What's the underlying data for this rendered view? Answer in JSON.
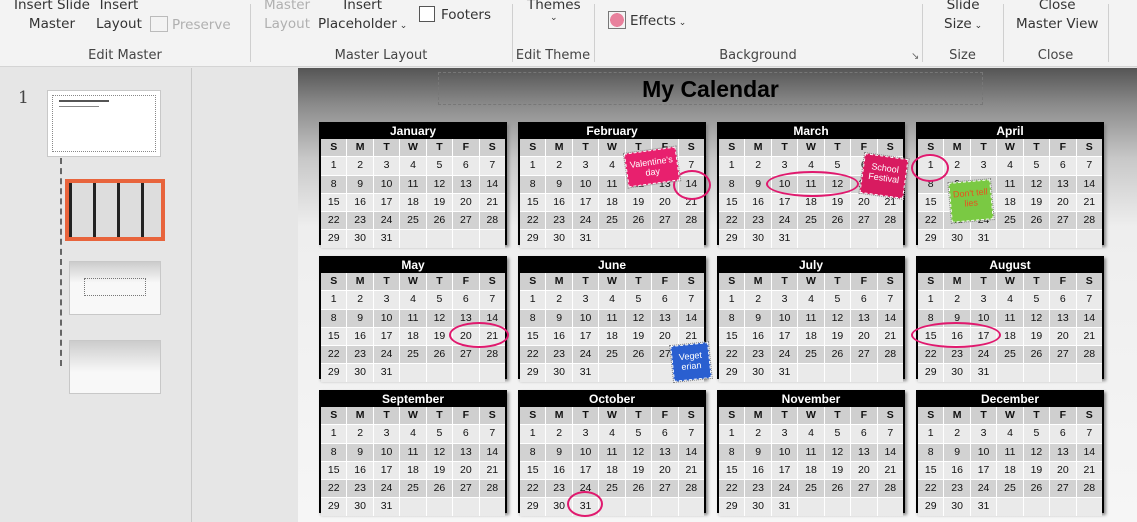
{
  "ribbon": {
    "insert_slide_master": [
      "Insert Slide",
      "Master"
    ],
    "insert_layout": [
      "Insert",
      "Layout"
    ],
    "preserve": "Preserve",
    "master_layout": [
      "Master",
      "Layout"
    ],
    "insert_placeholder": [
      "Insert",
      "Placeholder"
    ],
    "footers": "Footers",
    "footers_checked": false,
    "themes": "Themes",
    "effects": "Effects",
    "slide_size": [
      "Slide",
      "Size"
    ],
    "close_master_view": [
      "Close",
      "Master View"
    ],
    "groups": [
      "Edit Master",
      "Master Layout",
      "Edit Theme",
      "Background",
      "Size",
      "Close"
    ]
  },
  "pane": {
    "slide_number": "1"
  },
  "slide": {
    "title": "My Calendar",
    "weekdays": [
      "S",
      "M",
      "T",
      "W",
      "T",
      "F",
      "S"
    ],
    "months": [
      "January",
      "February",
      "March",
      "April",
      "May",
      "June",
      "July",
      "August",
      "September",
      "October",
      "November",
      "December"
    ],
    "days_in_month": 31,
    "stickers": [
      {
        "text": "Valentine's day",
        "color": "#e8206e"
      },
      {
        "text": "School Festival",
        "color": "#d81b60"
      },
      {
        "text": "Don't tell lies",
        "color": "#7ac943",
        "text_color": "#e8521e"
      },
      {
        "text": "Veget erian",
        "color": "#2a5fd0"
      }
    ],
    "circled_dates": [
      {
        "month": "February",
        "days": [
          14
        ]
      },
      {
        "month": "March",
        "days": [
          10,
          11,
          12
        ]
      },
      {
        "month": "April",
        "days": [
          1
        ]
      },
      {
        "month": "May",
        "days": [
          20,
          21
        ]
      },
      {
        "month": "August",
        "days": [
          15,
          16,
          17
        ]
      },
      {
        "month": "October",
        "days": [
          31
        ]
      }
    ],
    "accent": "#e0196e"
  }
}
